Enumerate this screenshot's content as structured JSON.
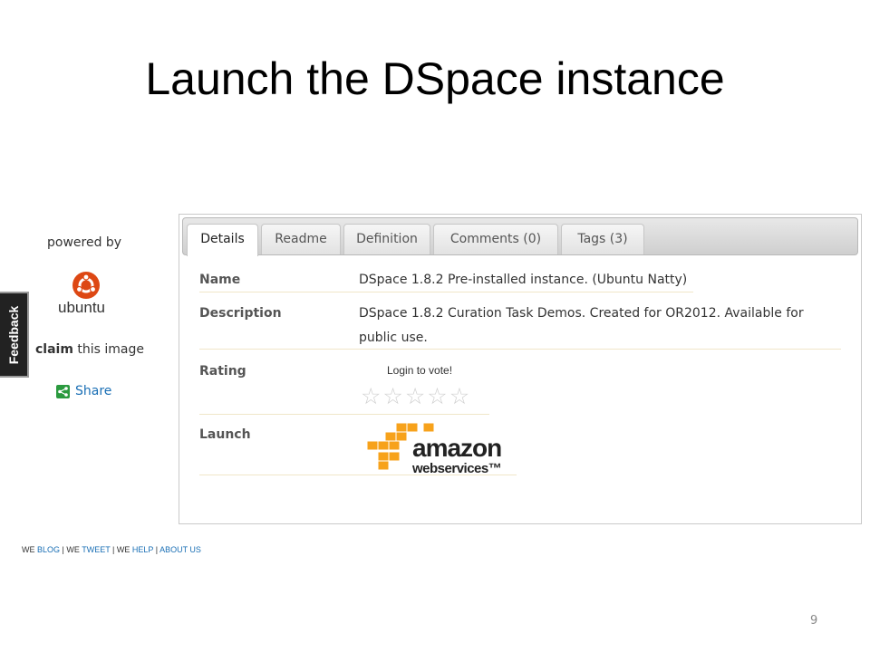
{
  "slide": {
    "title": "Launch the DSpace instance",
    "page_number": "9"
  },
  "sidebar": {
    "powered_by": "powered by",
    "brand": "ubuntu",
    "claim_bold": "claim",
    "claim_rest": " this image",
    "share": "Share",
    "feedback": "Feedback"
  },
  "tabs": [
    {
      "label": "Details",
      "active": true
    },
    {
      "label": "Readme",
      "active": false
    },
    {
      "label": "Definition",
      "active": false
    },
    {
      "label": "Comments (0)",
      "active": false
    },
    {
      "label": "Tags (3)",
      "active": false
    }
  ],
  "details": {
    "name_label": "Name",
    "name_value": "DSpace 1.8.2 Pre-installed instance. (Ubuntu Natty)",
    "description_label": "Description",
    "description_line1": "DSpace 1.8.2 Curation Task Demos. Created for OR2012. Available for",
    "description_line2": "public use.",
    "rating_label": "Rating",
    "rating_prompt": "Login to vote!",
    "rating_value": 0,
    "rating_max": 5,
    "launch_label": "Launch",
    "aws_word": "amazon",
    "aws_sub": "webservices™"
  },
  "footer": {
    "we1": "WE ",
    "blog": "BLOG",
    "sep1": " | WE ",
    "tweet": "TWEET",
    "sep2": " | WE ",
    "help": "HELP",
    "sep3": " | ",
    "about": "ABOUT US"
  },
  "colors": {
    "ubuntu_orange": "#dd4814",
    "aws_orange": "#f7a21b",
    "link_blue": "#1a6fb5",
    "share_green": "#2b9a3f"
  },
  "icons": [
    "ubuntu-logo-icon",
    "share-icon",
    "star-icon",
    "aws-cubes-icon"
  ]
}
